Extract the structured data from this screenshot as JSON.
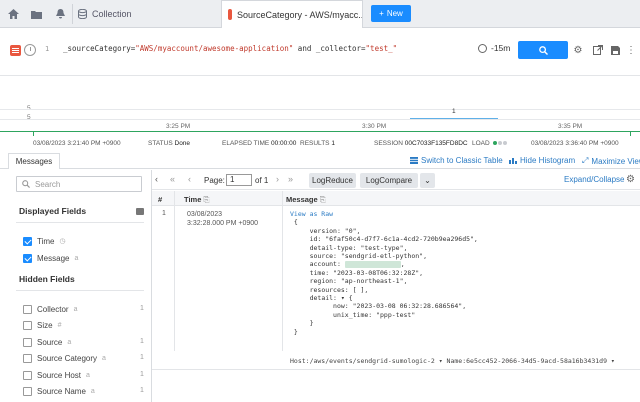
{
  "tabs": {
    "collection_label": "Collection",
    "active_label": "SourceCategory - AWS/myacc...",
    "new_label": "New"
  },
  "query": {
    "line_number": "1",
    "part1": "_sourceCategory=",
    "value1": "\"AWS/myaccount/awesome-application\"",
    "part2": " and _collector=",
    "value2": "\"test_\"",
    "time_range": "-15m"
  },
  "histogram": {
    "y_top": "5",
    "y_bottom": "5",
    "bar_count": "1",
    "ticks": [
      "3:25 PM",
      "3:30 PM",
      "3:35 PM"
    ],
    "start_time": "03/08/2023 3:21:40 PM +0900",
    "end_time": "03/08/2023 3:36:40 PM +0900"
  },
  "status": {
    "status_label": "STATUS",
    "status_value": "Done",
    "elapsed_label": "ELAPSED TIME",
    "elapsed_value": "00:00:00",
    "results_label": "RESULTS",
    "results_value": "1",
    "session_label": "SESSION",
    "session_value": "00C7033F135FD8DC",
    "load_label": "LOAD"
  },
  "view": {
    "messages_tab": "Messages",
    "switch_label": "Switch to Classic Table",
    "hide_hist_label": "Hide Histogram",
    "maximize_label": "Maximize View"
  },
  "sidebar": {
    "search_placeholder": "Search",
    "displayed_header": "Displayed Fields",
    "hidden_header": "Hidden Fields",
    "displayed": [
      {
        "label": "Time"
      },
      {
        "label": "Message"
      }
    ],
    "hidden": [
      {
        "label": "Collector",
        "count": "1"
      },
      {
        "label": "Size",
        "count": ""
      },
      {
        "label": "Source",
        "count": "1"
      },
      {
        "label": "Source Category",
        "count": "1"
      },
      {
        "label": "Source Host",
        "count": "1"
      },
      {
        "label": "Source Name",
        "count": "1"
      }
    ]
  },
  "pager": {
    "page_label": "Page:",
    "page_value": "1",
    "of_label": "of 1",
    "logreduce": "LogReduce",
    "logcompare": "LogCompare",
    "expand": "Expand/Collapse"
  },
  "table": {
    "col_num": "#",
    "col_time": "Time",
    "col_message": "Message",
    "row_num": "1",
    "row_date": "03/08/2023",
    "row_time": "3:32:28.000 PM +0900",
    "view_as": "View as Raw",
    "json_lines": [
      "{",
      "  version: \"0\",",
      "  id: \"6faf50c4-d7f7-6c1a-4cd2-720b9ea296d5\",",
      "  detail-type: \"test-type\",",
      "  source: \"sendgrid-etl-python\",",
      "  account: ",
      "  time: \"2023-03-08T06:32:28Z\",",
      "  region: \"ap-northeast-1\",",
      "  resources: [ ],",
      "  detail: ▾ {",
      "    now: \"2023-03-08 06:32:28.686564\",",
      "    unix_time: \"ppp-test\"",
      "  }",
      "}"
    ],
    "host": "Host:/aws/events/sendgrid-sumologic-2",
    "name": "Name:6e5cc452-2066-34d5-9acd-58a16b3431d9"
  },
  "colors": {
    "accent": "#1a8cff",
    "logo": "#e9573f",
    "link": "#2b7bc4",
    "histogram_green": "#2ea55e"
  }
}
